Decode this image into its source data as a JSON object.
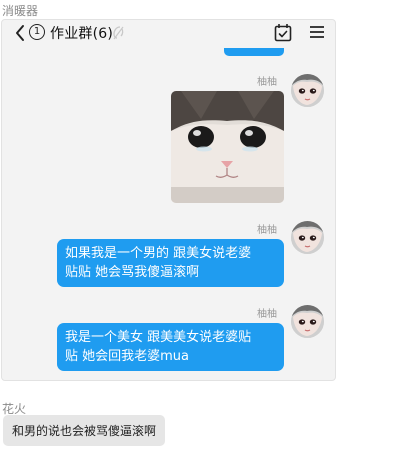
{
  "top_sender": "消暖器",
  "header": {
    "unread_count": "1",
    "title": "作业群(6)",
    "icons": [
      "back-icon",
      "mute-icon",
      "calendar-icon",
      "menu-icon"
    ]
  },
  "messages": [
    {
      "sender": "柚柚",
      "type": "image",
      "image_desc": "crying-cat-sticker"
    },
    {
      "sender": "柚柚",
      "type": "text",
      "lines": [
        "如果我是一个男的 跟美女说老婆",
        "贴贴 她会骂我傻逼滚啊"
      ]
    },
    {
      "sender": "柚柚",
      "type": "text",
      "lines": [
        "我是一个美女 跟美美女说老婆贴",
        "贴 她会回我老婆mua"
      ]
    }
  ],
  "bottom_sender": "花火",
  "bottom_message": "和男的说也会被骂傻逼滚啊",
  "colors": {
    "bubble_blue": "#1f9cf0",
    "card_bg": "#f3f3f3",
    "grey_bubble": "#e6e6e6"
  }
}
